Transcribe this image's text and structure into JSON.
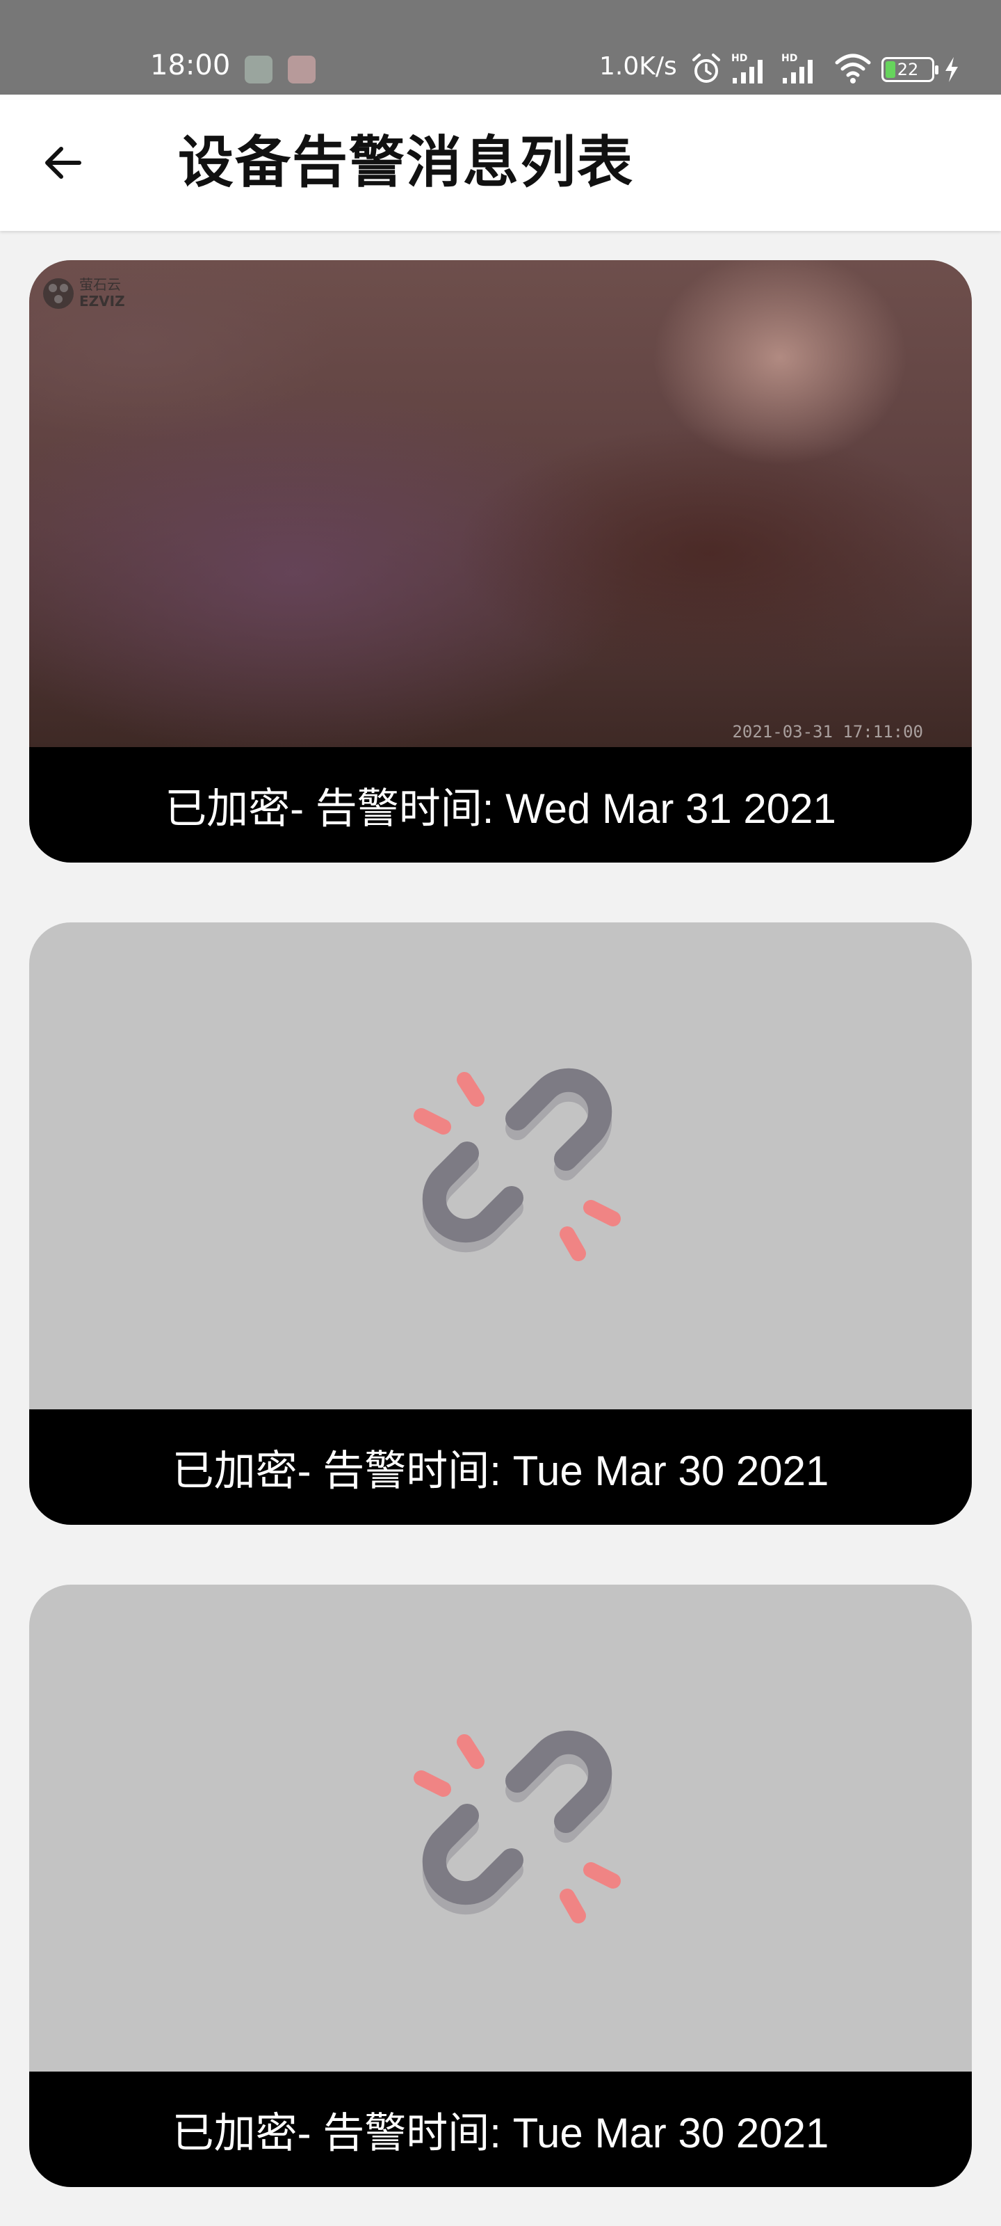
{
  "status_bar": {
    "time": "18:00",
    "network_speed": "1.0K/s",
    "battery_level": "22",
    "icons": [
      "app-notification-icon",
      "app-notification-icon",
      "alarm-icon",
      "hd-signal-icon",
      "hd-signal-icon",
      "wifi-icon",
      "battery-icon",
      "charging-icon"
    ]
  },
  "app_bar": {
    "title": "设备告警消息列表",
    "back_icon": "arrow-left-icon"
  },
  "alarms": [
    {
      "caption": "已加密- 告警时间: Wed Mar 31 2021",
      "image": "camera-snapshot",
      "watermark": "萤石云 EZVIZ",
      "timestamp": "2021-03-31 17:11:00"
    },
    {
      "caption": "已加密- 告警时间: Tue Mar 30 2021",
      "image": "broken-link-icon"
    },
    {
      "caption": "已加密- 告警时间: Tue Mar 30 2021",
      "image": "broken-link-icon"
    }
  ],
  "colors": {
    "status_bar": "#777777",
    "app_bar": "#ffffff",
    "page_background": "#f2f2f2",
    "placeholder": "#c3c3c3",
    "caption_bar": "#000000",
    "broken_link_gray": "#7d7b84",
    "broken_link_red": "#f08484"
  }
}
